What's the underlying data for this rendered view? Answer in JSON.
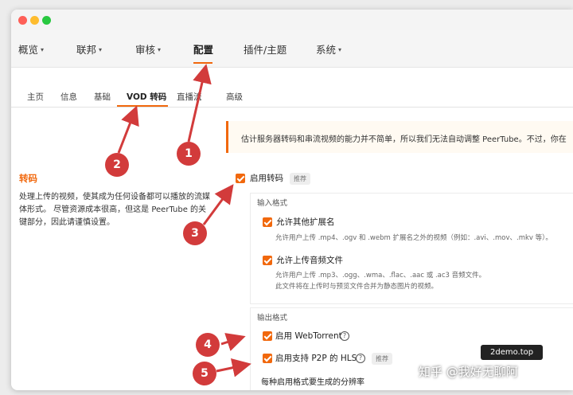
{
  "window": {
    "controls": [
      "close",
      "minimize",
      "zoom"
    ]
  },
  "top_nav": {
    "items": [
      {
        "label": "概览",
        "has_caret": true
      },
      {
        "label": "联邦",
        "has_caret": true
      },
      {
        "label": "审核",
        "has_caret": true
      },
      {
        "label": "配置",
        "has_caret": false,
        "active": true
      },
      {
        "label": "插件/主题",
        "has_caret": false
      },
      {
        "label": "系统",
        "has_caret": true
      }
    ],
    "caret": "▾"
  },
  "sub_tabs": {
    "items": [
      "主页",
      "信息",
      "基础",
      "VOD 转码",
      "直播流",
      "高级"
    ],
    "active": "VOD 转码"
  },
  "notice": {
    "text": "估计服务器转码和串流视频的能力并不简单，所以我们无法自动调整 PeerTube。不过，你在"
  },
  "section": {
    "title": "转码",
    "description": "处理上传的视频，使其成为任何设备都可以播放的流媒体形式。 尽管资源成本很高，但这是 PeerTube 的关键部分，因此请谨慎设置。"
  },
  "enable_transcoding": {
    "label": "启用转码",
    "checked": true,
    "tag": "推荐"
  },
  "input_formats": {
    "title": "输入格式",
    "allow_extensions": {
      "label": "允许其他扩展名",
      "checked": true,
      "hint": "允许用户上传 .mp4、.ogv 和 .webm 扩展名之外的视频（例如：.avi、.mov、.mkv 等）。"
    },
    "allow_audio": {
      "label": "允许上传音频文件",
      "checked": true,
      "hint_1": "允许用户上传 .mp3、.ogg、.wma、.flac、.aac 或 .ac3 音频文件。",
      "hint_2": "此文件将在上传时与预览文件合并为静态图片的视频。"
    }
  },
  "output_formats": {
    "title": "输出格式",
    "webtorrent": {
      "label": "启用 WebTorrent",
      "checked": true,
      "help": "?"
    },
    "hls": {
      "label": "启用支持 P2P 的 HLS",
      "checked": true,
      "help": "?",
      "tag": "推荐"
    },
    "resolutions_label": "每种启用格式要生成的分辨率"
  },
  "annotations": [
    "1",
    "2",
    "3",
    "4",
    "5"
  ],
  "annotation_color": "#d23b3b",
  "accent_color": "#f1680d",
  "watermark": {
    "site": "2demo.top",
    "zhihu": "知乎 @我好无聊阿"
  }
}
